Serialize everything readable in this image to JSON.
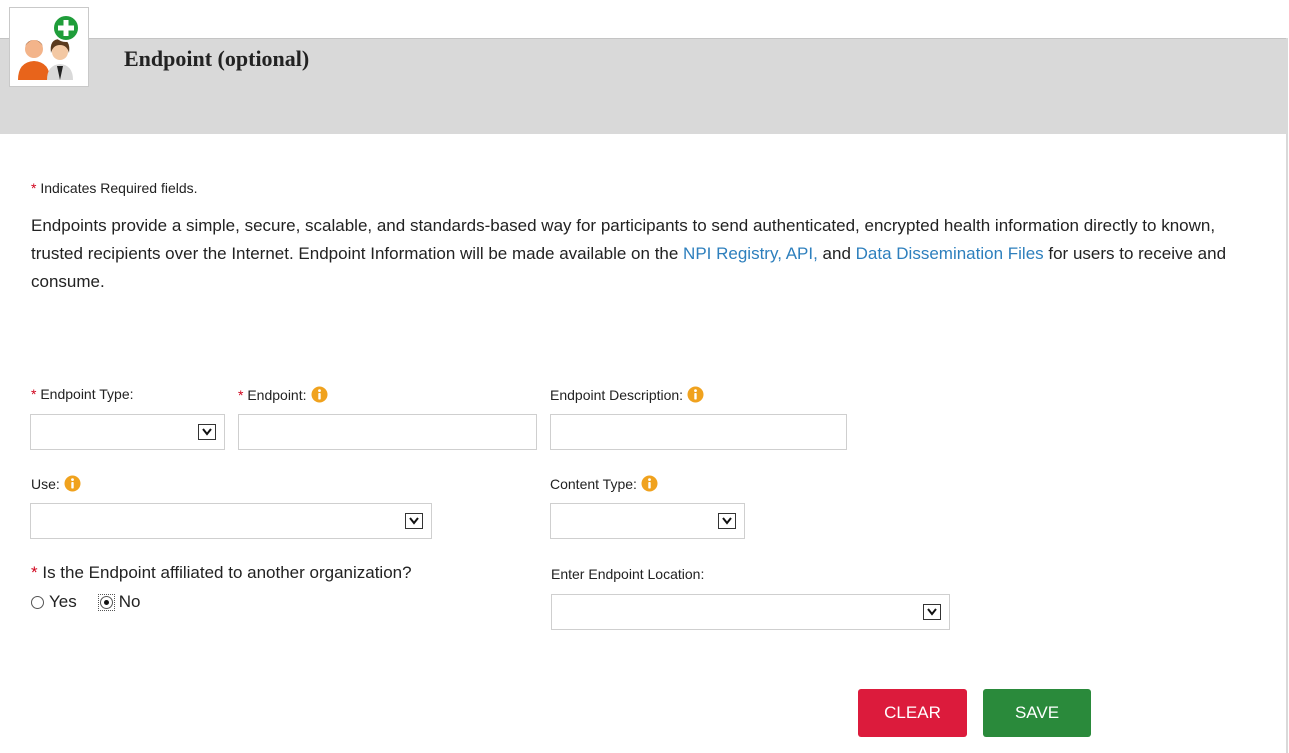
{
  "header": {
    "title": "Endpoint (optional)",
    "icon": "add-users-icon"
  },
  "required_note": {
    "star": "*",
    "text": " Indicates Required fields."
  },
  "intro": {
    "part1": "Endpoints provide a simple, secure, scalable, and standards-based way for participants to send authenticated, encrypted health information directly to known, trusted recipients over the Internet.  Endpoint Information will be made available on the ",
    "link_npi": "NPI Registry, API,",
    "and": " and ",
    "link_data": "Data Dissemination Files",
    "part2": " for users to receive and consume."
  },
  "form": {
    "endpoint_type": {
      "star": "*",
      "label": " Endpoint Type:",
      "value": ""
    },
    "endpoint": {
      "star": "*",
      "label": " Endpoint:",
      "value": ""
    },
    "endpoint_description": {
      "label": "Endpoint Description:",
      "value": ""
    },
    "use": {
      "label": "Use:",
      "value": ""
    },
    "content_type": {
      "label": "Content Type:",
      "value": ""
    },
    "affiliated": {
      "star": "*",
      "label": " Is the Endpoint affiliated to another organization?",
      "options": [
        "Yes",
        "No"
      ],
      "selected": "No"
    },
    "endpoint_location": {
      "label": "Enter Endpoint Location:",
      "value": ""
    }
  },
  "buttons": {
    "clear": "CLEAR",
    "save": "SAVE"
  },
  "colors": {
    "required": "#d0021b",
    "link": "#2d7fbd",
    "clear_button": "#dc1b3c",
    "save_button": "#2a8a3b",
    "header_bg": "#d9d9d9",
    "info_icon": "#f0a21e"
  }
}
